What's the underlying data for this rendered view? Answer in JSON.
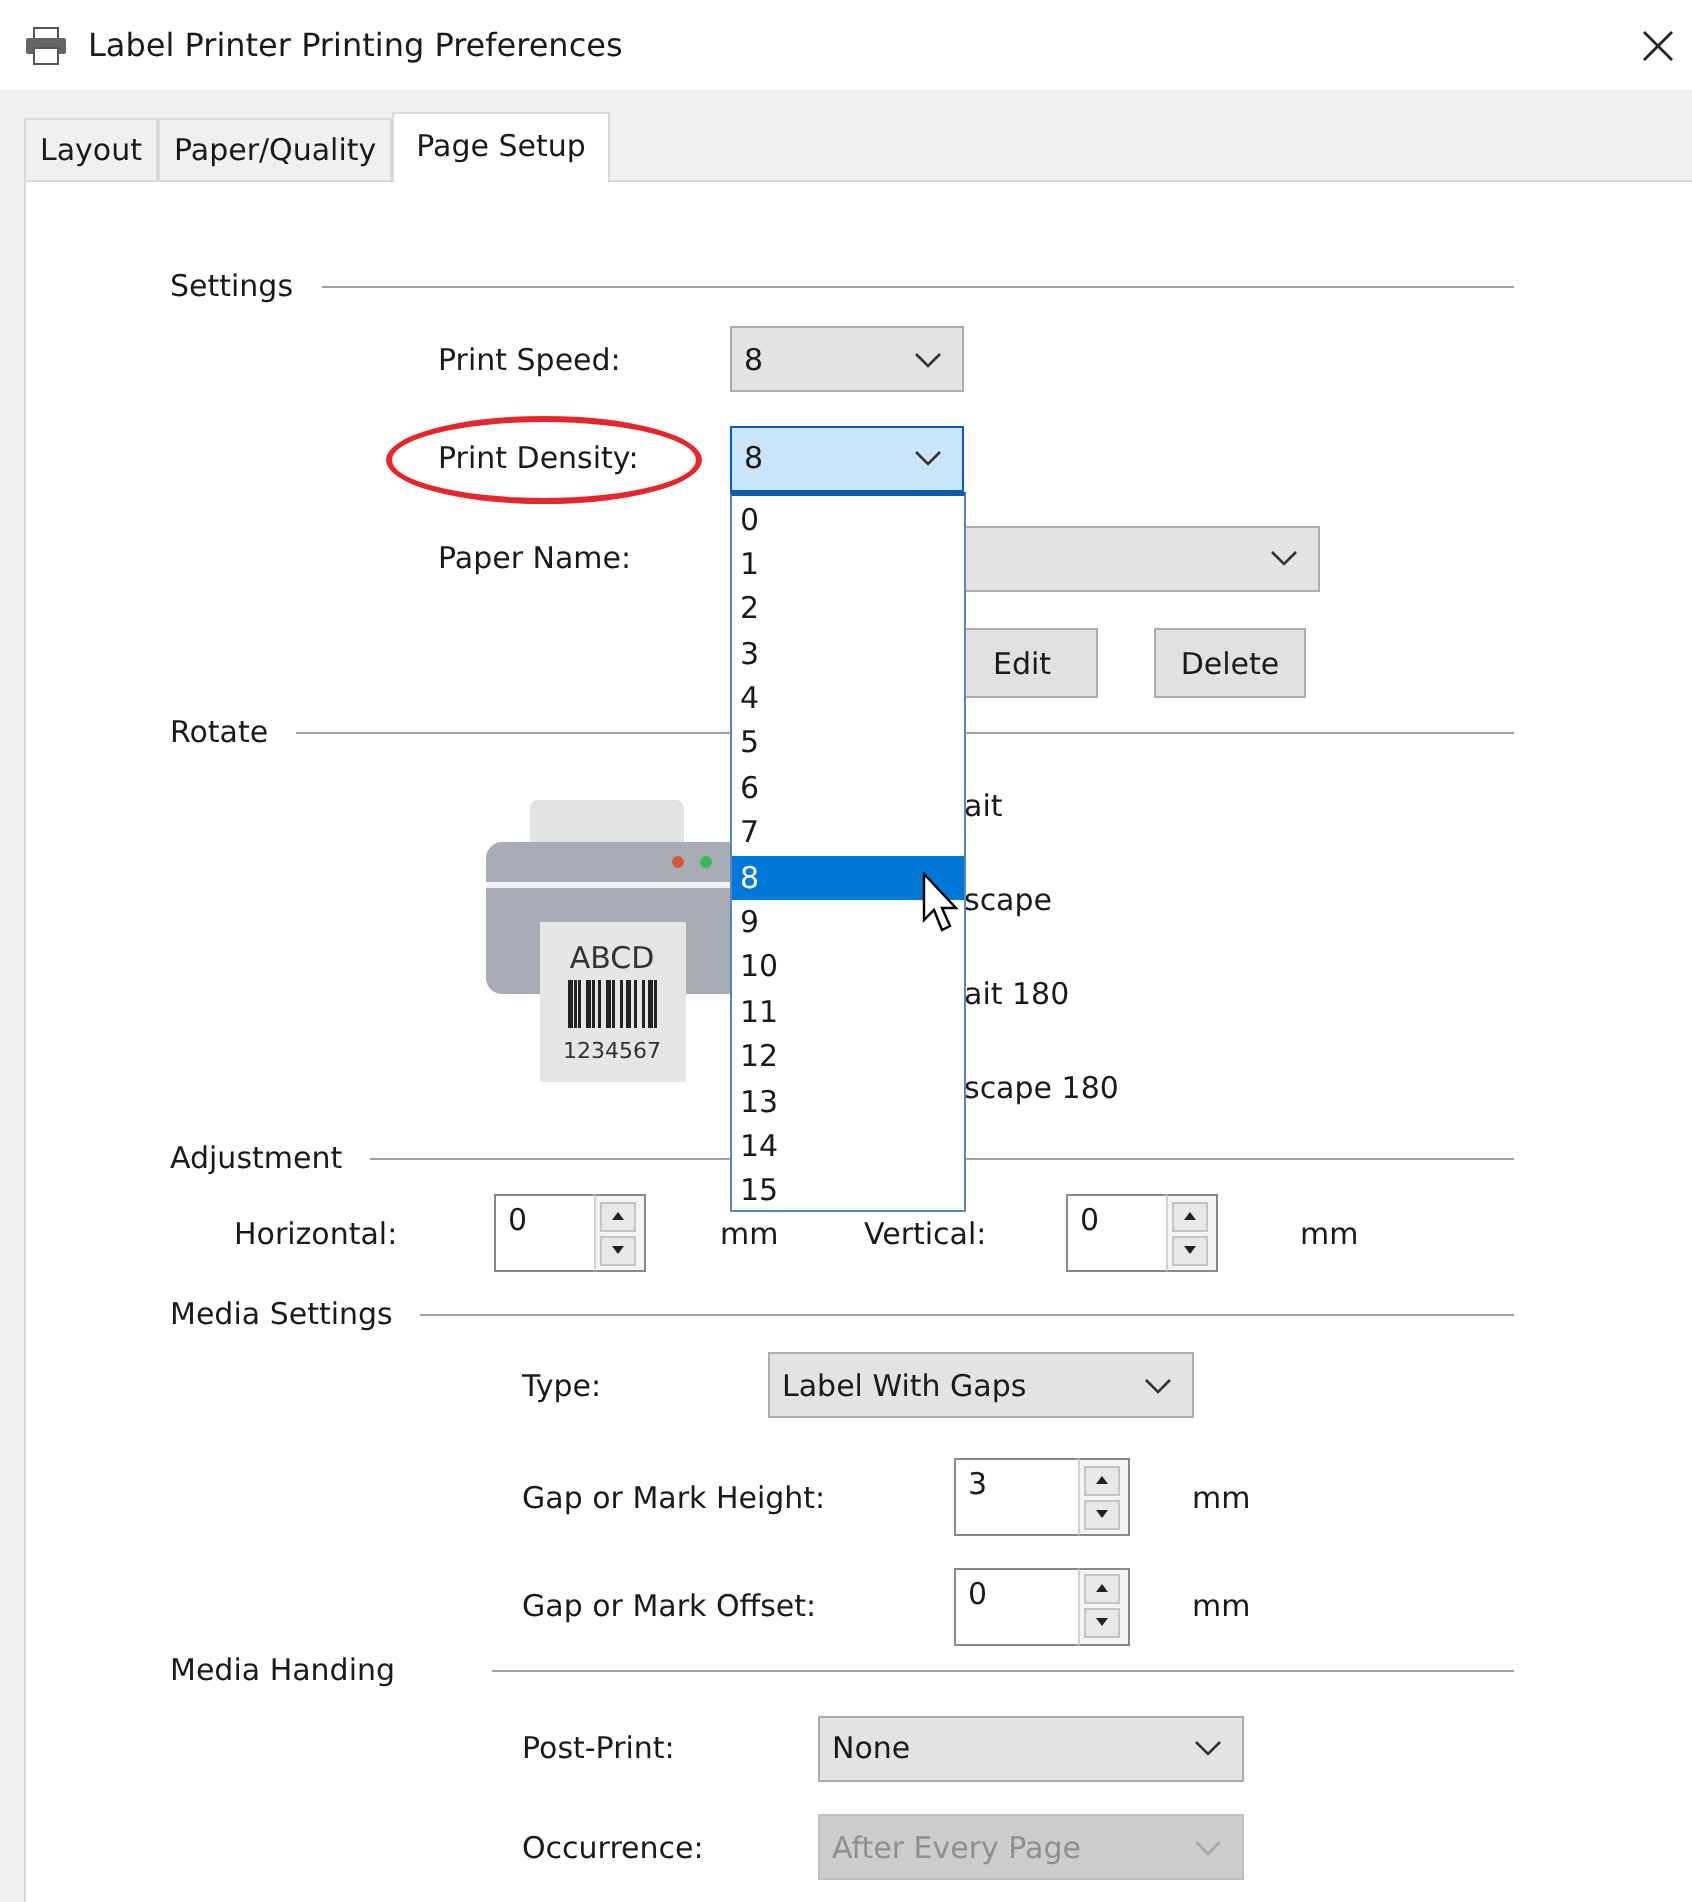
{
  "window": {
    "title": "Label Printer Printing Preferences"
  },
  "tabs": [
    {
      "label": "Layout",
      "selected": false
    },
    {
      "label": "Paper/Quality",
      "selected": false
    },
    {
      "label": "Page Setup",
      "selected": true
    }
  ],
  "sections": [
    {
      "kind": "settings",
      "title": "Settings",
      "rows": [
        {
          "fields": [
            {
              "label": "Print Speed:",
              "control": {
                "kind": "combo",
                "value": "8",
                "disabled": false
              }
            }
          ]
        },
        {
          "fields": [
            {
              "label": "Print Density:",
              "circled": true,
              "control": {
                "kind": "combo",
                "value": "8",
                "open": true,
                "disabled": false,
                "options": [
                  {
                    "label": "0",
                    "selected": false
                  },
                  {
                    "label": "1",
                    "selected": false
                  },
                  {
                    "label": "2",
                    "selected": false
                  },
                  {
                    "label": "3",
                    "selected": false
                  },
                  {
                    "label": "4",
                    "selected": false
                  },
                  {
                    "label": "5",
                    "selected": false
                  },
                  {
                    "label": "6",
                    "selected": false
                  },
                  {
                    "label": "7",
                    "selected": false
                  },
                  {
                    "label": "8",
                    "selected": true
                  },
                  {
                    "label": "9",
                    "selected": false
                  },
                  {
                    "label": "10",
                    "selected": false
                  },
                  {
                    "label": "11",
                    "selected": false
                  },
                  {
                    "label": "12",
                    "selected": false
                  },
                  {
                    "label": "13",
                    "selected": false
                  },
                  {
                    "label": "14",
                    "selected": false
                  },
                  {
                    "label": "15",
                    "selected": false
                  }
                ]
              }
            }
          ]
        },
        {
          "fields": [
            {
              "label": "Paper Name:",
              "control": {
                "kind": "combo",
                "disabled": false
              }
            }
          ]
        },
        {
          "buttons": [
            {
              "label": "Edit"
            },
            {
              "label": "Delete"
            }
          ]
        }
      ]
    },
    {
      "kind": "rotate",
      "title": "Rotate",
      "preview": {
        "label_text": "ABCD",
        "code_text": "1234567"
      },
      "options": [
        {
          "label": "ait"
        },
        {
          "label": "scape"
        },
        {
          "label": "ait 180"
        },
        {
          "label": "scape 180"
        }
      ]
    },
    {
      "kind": "adjustment",
      "title": "Adjustment",
      "rows": [
        {
          "fields": [
            {
              "label": "Horizontal:",
              "control": {
                "kind": "spin",
                "value": "0"
              },
              "unit": "mm"
            },
            {
              "label": "Vertical:",
              "control": {
                "kind": "spin",
                "value": "0"
              },
              "unit": "mm"
            }
          ]
        }
      ]
    },
    {
      "kind": "media",
      "title": "Media Settings",
      "rows": [
        {
          "fields": [
            {
              "label": "Type:",
              "control": {
                "kind": "combo",
                "value": "Label With Gaps",
                "disabled": false
              }
            }
          ]
        },
        {
          "fields": [
            {
              "label": "Gap or Mark Height:",
              "control": {
                "kind": "spin",
                "value": "3"
              },
              "unit": "mm"
            }
          ]
        },
        {
          "fields": [
            {
              "label": "Gap or Mark Offset:",
              "control": {
                "kind": "spin",
                "value": "0"
              },
              "unit": "mm"
            }
          ]
        }
      ]
    },
    {
      "kind": "handling",
      "title": "Media Handing",
      "rows": [
        {
          "fields": [
            {
              "label": "Post-Print:",
              "control": {
                "kind": "combo",
                "value": "None",
                "disabled": false
              }
            }
          ]
        },
        {
          "fields": [
            {
              "label": "Occurrence:",
              "control": {
                "kind": "combo",
                "value": "After Every Page",
                "disabled": true
              }
            }
          ]
        }
      ]
    }
  ]
}
